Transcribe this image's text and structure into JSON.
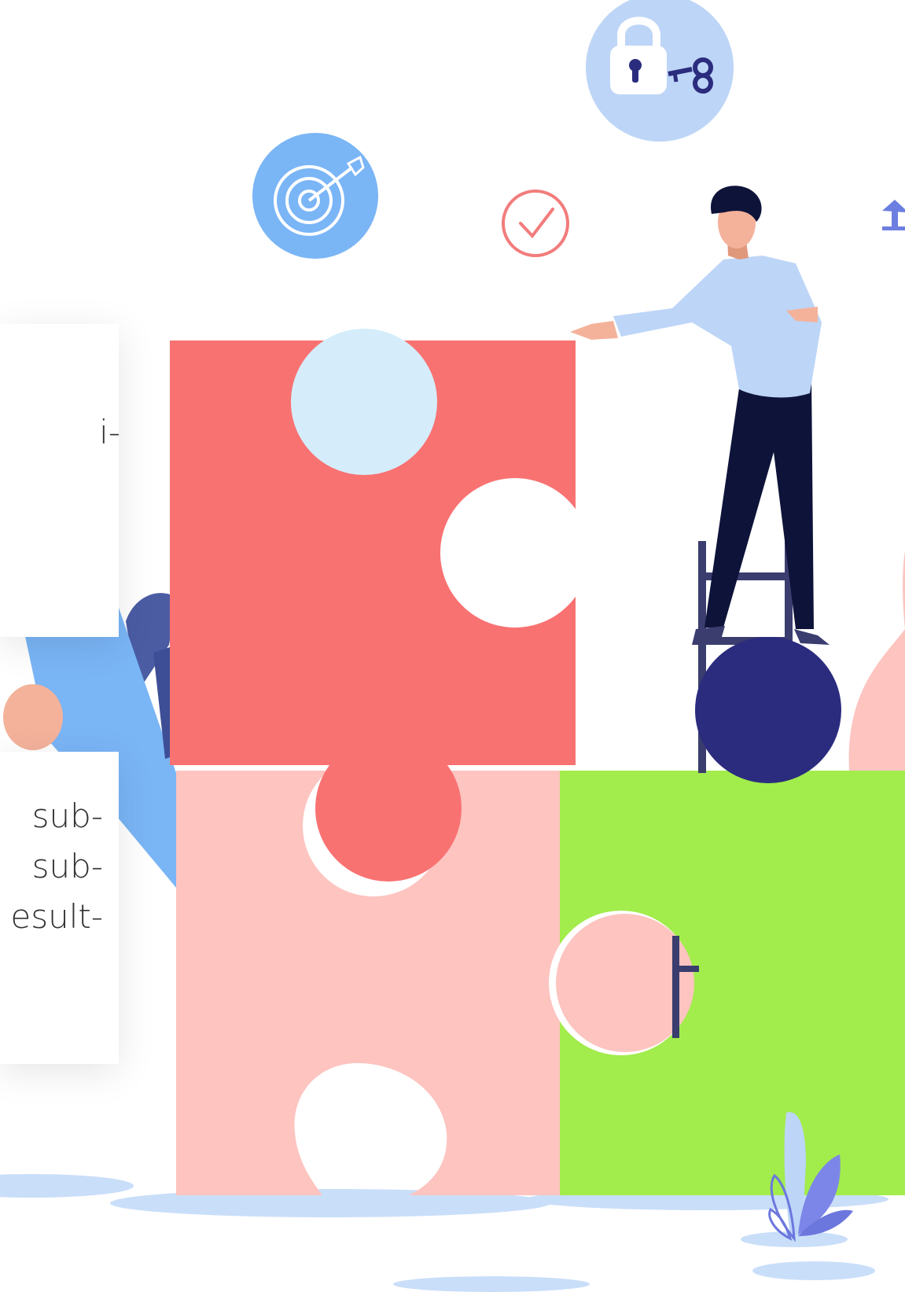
{
  "cards": [
    {
      "lines": [
        "i-"
      ]
    },
    {
      "lines": [
        "sub-",
        "sub-",
        "esult-"
      ]
    }
  ],
  "icons": {
    "target": "target-arrow-icon",
    "lock": "padlock-key-icon",
    "check": "checkmark-circle-icon",
    "upload": "upload-arrow-icon"
  },
  "colors": {
    "puzzle_red": "#F97272",
    "puzzle_pink": "#FDC4C0",
    "puzzle_green": "#A2EC4C",
    "navy": "#0E1339",
    "light_blue": "#BDD5F7",
    "accent_blue": "#7AB5F6",
    "indigo": "#2B2C7E"
  }
}
